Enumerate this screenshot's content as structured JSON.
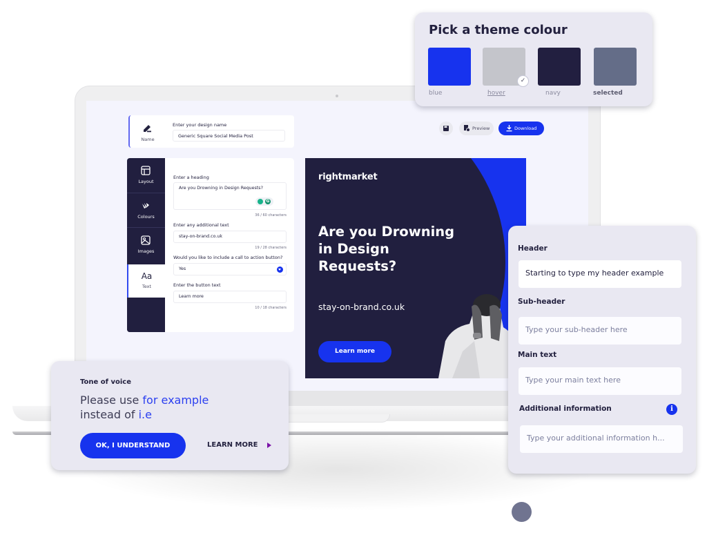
{
  "editor": {
    "name_tab_label": "Name",
    "design_name_label": "Enter your design name",
    "design_name_value": "Generic Square Social Media Post",
    "toolbar": {
      "save_icon": "floppy-disk-icon",
      "preview_label": "Preview",
      "download_label": "Download"
    },
    "sidebar": {
      "items": [
        {
          "label": "Layout",
          "icon": "layout-icon"
        },
        {
          "label": "Colours",
          "icon": "palette-icon"
        },
        {
          "label": "Images",
          "icon": "image-icon"
        },
        {
          "label": "Text",
          "icon_text": "Aa",
          "active": true
        }
      ]
    },
    "fields": {
      "heading_label": "Enter a heading",
      "heading_value": "Are you Drowning in Design Requests?",
      "heading_counter": "36 / 60 characters",
      "additional_label": "Enter any additional text",
      "additional_value": "stay-on-brand.co.uk",
      "additional_counter": "19 / 28 characters",
      "cta_question": "Would you like to include a call to action button?",
      "cta_value": "Yes",
      "button_text_label": "Enter the button text",
      "button_text_value": "Learn more",
      "button_text_counter": "10 / 18 characters"
    }
  },
  "post_preview": {
    "logo": "rightmarket",
    "headline": "Are you Drowning in Design Requests?",
    "url": "stay-on-brand.co.uk",
    "cta": "Learn more",
    "colors": {
      "navy": "#211f3f",
      "blue": "#1733ee"
    }
  },
  "theme_picker": {
    "title": "Pick a theme colour",
    "swatches": [
      {
        "label": "blue",
        "color": "#1733ee"
      },
      {
        "label": "hover",
        "color": "#c4c5cb",
        "checked": true
      },
      {
        "label": "navy",
        "color": "#221f40"
      },
      {
        "label": "selected",
        "color": "#646d88"
      }
    ]
  },
  "text_form": {
    "header_label": "Header",
    "header_value": "Starting to type my header example",
    "subheader_label": "Sub-header",
    "subheader_placeholder": "Type your sub-header here",
    "main_label": "Main text",
    "main_placeholder": "Type your main text here",
    "additional_label": "Additional information",
    "additional_placeholder": "Type your additional information h..."
  },
  "tone_of_voice": {
    "title": "Tone of voice",
    "msg_prefix": "Please use ",
    "msg_highlight1": "for example",
    "msg_middle": "instead of ",
    "msg_highlight2": "i.e",
    "ok_label": "OK, I UNDERSTAND",
    "learn_label": "LEARN MORE"
  }
}
